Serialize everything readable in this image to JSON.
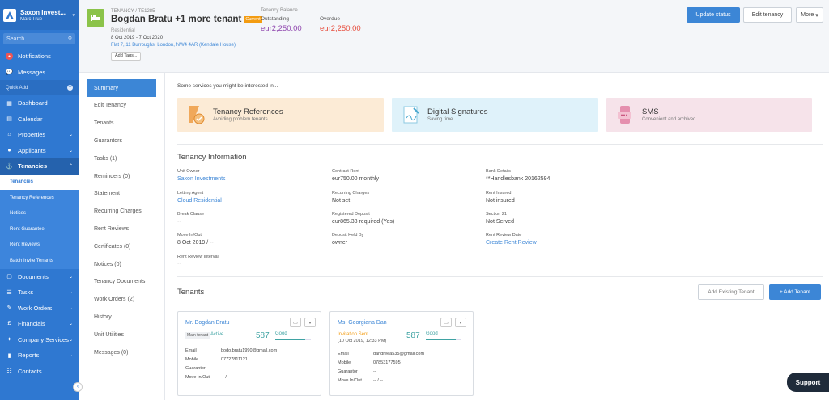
{
  "sidebar": {
    "brand_name": "Saxon Invest...",
    "brand_user": "Marc Trup",
    "search_placeholder": "Search...",
    "notifications": "Notifications",
    "messages": "Messages",
    "quick_add": "Quick Add",
    "items": [
      {
        "label": "Dashboard",
        "icon": "dashboard-icon"
      },
      {
        "label": "Calendar",
        "icon": "calendar-icon"
      },
      {
        "label": "Properties",
        "icon": "home-icon"
      },
      {
        "label": "Applicants",
        "icon": "user-icon"
      },
      {
        "label": "Tenancies",
        "icon": "tenancy-icon"
      }
    ],
    "tenancies_sub": [
      "Tenancies",
      "Tenancy References",
      "Notices",
      "Rent Guarantee",
      "Rent Reviews",
      "Batch Invite Tenants"
    ],
    "items_after": [
      {
        "label": "Documents",
        "icon": "document-icon"
      },
      {
        "label": "Tasks",
        "icon": "tasks-icon"
      },
      {
        "label": "Work Orders",
        "icon": "wrench-icon"
      },
      {
        "label": "Financials",
        "icon": "pound-icon"
      },
      {
        "label": "Company Services",
        "icon": "services-icon"
      },
      {
        "label": "Reports",
        "icon": "reports-icon"
      },
      {
        "label": "Contacts",
        "icon": "contacts-icon"
      }
    ]
  },
  "header": {
    "code": "TENANCY / TE1285",
    "title": "Bogdan Bratu +1 more tenant",
    "badge": "Current",
    "type": "Residential",
    "dates": "8 Oct 2019 - 7 Oct 2020",
    "address": "Flat 7, 11 Burroughs, London, NW4 4AR (Kendale House)",
    "add_tags": "Add Tags...",
    "balance_title": "Tenancy Balance",
    "outstanding_label": "Outstanding",
    "outstanding_value": "eur2,250.00",
    "overdue_label": "Overdue",
    "overdue_value": "eur2,250.00",
    "update_status": "Update status",
    "edit_tenancy": "Edit tenancy",
    "more": "More"
  },
  "tabs": [
    "Summary",
    "Edit Tenancy",
    "Tenants",
    "Guarantors",
    "Tasks (1)",
    "Reminders (0)",
    "Statement",
    "Recurring Charges",
    "Rent Reviews",
    "Certificates (0)",
    "Notices (0)",
    "Tenancy Documents",
    "Work Orders (2)",
    "History",
    "Unit Utilities",
    "Messages (0)"
  ],
  "services": {
    "intro": "Some services you might be interested in...",
    "items": [
      {
        "name": "Tenancy References",
        "desc": "Avoiding problem tenants"
      },
      {
        "name": "Digital Signatures",
        "desc": "Saving time"
      },
      {
        "name": "SMS",
        "desc": "Convenient and archived"
      }
    ]
  },
  "info": {
    "title": "Tenancy Information",
    "fields": [
      {
        "label": "Unit Owner",
        "value": "Saxon Investments",
        "link": true
      },
      {
        "label": "Contract Rent",
        "value": "eur750.00 monthly",
        "link": false
      },
      {
        "label": "Bank Details",
        "value": "**Handlesbank 20162594",
        "link": false
      },
      {
        "label": "Letting Agent",
        "value": "Cloud Residential",
        "link": true
      },
      {
        "label": "Recurring Charges",
        "value": "Not set",
        "link": false
      },
      {
        "label": "Rent Insured",
        "value": "Not insured",
        "link": false
      },
      {
        "label": "Break Clause",
        "value": "--",
        "link": false
      },
      {
        "label": "Registered Deposit",
        "value": "eur865.38 required (Yes)",
        "link": false
      },
      {
        "label": "Section 21",
        "value": "Not Served",
        "link": false
      },
      {
        "label": "Move In/Out",
        "value": "8 Oct 2019 / --",
        "link": false
      },
      {
        "label": "Deposit Held By",
        "value": "owner",
        "link": false
      },
      {
        "label": "Rent Review Date",
        "value": "Create Rent Review",
        "link": true
      },
      {
        "label": "Rent Review Interval",
        "value": "--",
        "link": false
      }
    ]
  },
  "tenants": {
    "title": "Tenants",
    "add_existing": "Add Existing Tenant",
    "add_tenant": "+ Add Tenant",
    "cards": [
      {
        "name": "Mr. Bogdan Bratu",
        "tag": "Main tenant",
        "status": "Active",
        "status2": "",
        "score": "587",
        "score_label": "Good",
        "score_fraction": 0.85,
        "email": "bodo.bratu1990@gmail.com",
        "mobile": "07727811121",
        "guarantor": "--",
        "move": "-- / --"
      },
      {
        "name": "Ms. Georgiana Dan",
        "tag": "",
        "status": "Invitation Sent",
        "status2": "(10 Oct 2019, 12:33 PM)",
        "score": "587",
        "score_label": "Good",
        "score_fraction": 0.85,
        "email": "dandreea535@gmail.com",
        "mobile": "07853177595",
        "guarantor": "--",
        "move": "-- / --"
      }
    ],
    "labels": {
      "email": "Email",
      "mobile": "Mobile",
      "guarantor": "Guarantor",
      "move": "Move In/Out"
    }
  },
  "support": "Support",
  "colors": {
    "sidebar": "#2f78d1",
    "primary": "#3c86d6",
    "badge": "#f39c12",
    "overdue": "#e74c3c",
    "outstanding": "#8e44ad"
  }
}
